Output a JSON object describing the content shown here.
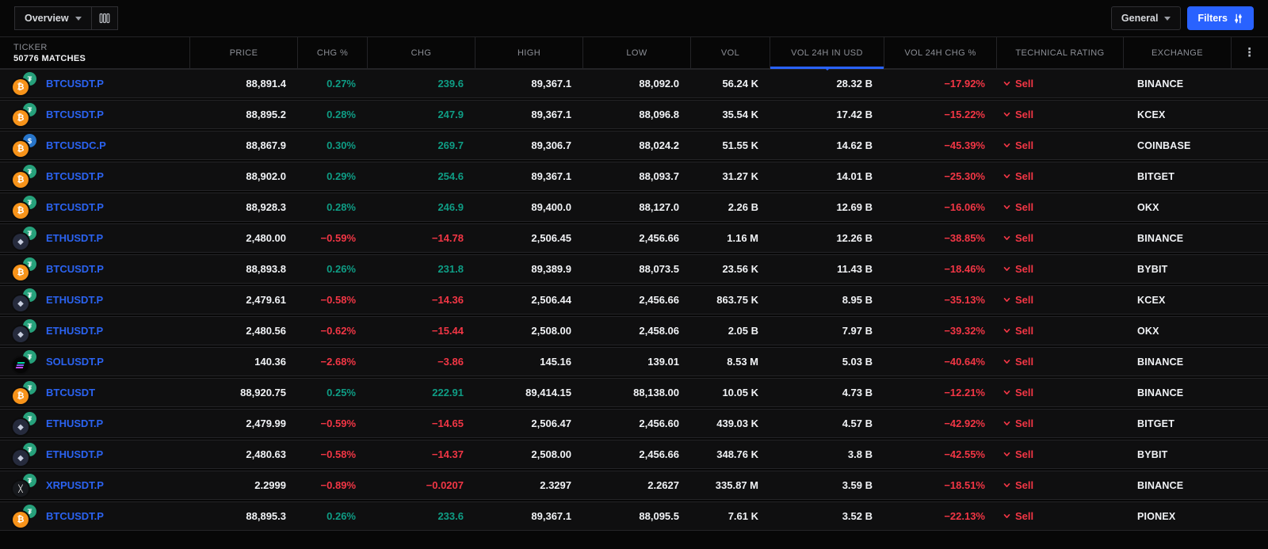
{
  "colors": {
    "accent": "#2962ff",
    "up": "#0f9d85",
    "down": "#f23645",
    "link": "#2b63f1"
  },
  "toolbar": {
    "view_dropdown": "Overview",
    "general_dropdown": "General",
    "filters_button": "Filters"
  },
  "table": {
    "ticker_header": "TICKER",
    "matches": "50776 MATCHES",
    "columns": [
      "PRICE",
      "CHG %",
      "CHG",
      "HIGH",
      "LOW",
      "VOL",
      "VOL 24H IN USD",
      "VOL 24H CHG %",
      "TECHNICAL RATING",
      "EXCHANGE"
    ],
    "sorted_column": "VOL 24H IN USD",
    "rows": [
      {
        "ticker": "BTCUSDT.P",
        "base": "BTC",
        "quote": "USDT",
        "price": "88,891.4",
        "chg_pct": "0.27%",
        "chg": "239.6",
        "high": "89,367.1",
        "low": "88,092.0",
        "vol": "56.24 K",
        "vol_usd": "28.32 B",
        "vol_chg": "−17.92%",
        "rating": "Sell",
        "exchange": "BINANCE"
      },
      {
        "ticker": "BTCUSDT.P",
        "base": "BTC",
        "quote": "USDT",
        "price": "88,895.2",
        "chg_pct": "0.28%",
        "chg": "247.9",
        "high": "89,367.1",
        "low": "88,096.8",
        "vol": "35.54 K",
        "vol_usd": "17.42 B",
        "vol_chg": "−15.22%",
        "rating": "Sell",
        "exchange": "KCEX"
      },
      {
        "ticker": "BTCUSDC.P",
        "base": "BTC",
        "quote": "USDC",
        "price": "88,867.9",
        "chg_pct": "0.30%",
        "chg": "269.7",
        "high": "89,306.7",
        "low": "88,024.2",
        "vol": "51.55 K",
        "vol_usd": "14.62 B",
        "vol_chg": "−45.39%",
        "rating": "Sell",
        "exchange": "COINBASE"
      },
      {
        "ticker": "BTCUSDT.P",
        "base": "BTC",
        "quote": "USDT",
        "price": "88,902.0",
        "chg_pct": "0.29%",
        "chg": "254.6",
        "high": "89,367.1",
        "low": "88,093.7",
        "vol": "31.27 K",
        "vol_usd": "14.01 B",
        "vol_chg": "−25.30%",
        "rating": "Sell",
        "exchange": "BITGET"
      },
      {
        "ticker": "BTCUSDT.P",
        "base": "BTC",
        "quote": "USDT",
        "price": "88,928.3",
        "chg_pct": "0.28%",
        "chg": "246.9",
        "high": "89,400.0",
        "low": "88,127.0",
        "vol": "2.26 B",
        "vol_usd": "12.69 B",
        "vol_chg": "−16.06%",
        "rating": "Sell",
        "exchange": "OKX"
      },
      {
        "ticker": "ETHUSDT.P",
        "base": "ETH",
        "quote": "USDT",
        "price": "2,480.00",
        "chg_pct": "−0.59%",
        "chg": "−14.78",
        "high": "2,506.45",
        "low": "2,456.66",
        "vol": "1.16 M",
        "vol_usd": "12.26 B",
        "vol_chg": "−38.85%",
        "rating": "Sell",
        "exchange": "BINANCE"
      },
      {
        "ticker": "BTCUSDT.P",
        "base": "BTC",
        "quote": "USDT",
        "price": "88,893.8",
        "chg_pct": "0.26%",
        "chg": "231.8",
        "high": "89,389.9",
        "low": "88,073.5",
        "vol": "23.56 K",
        "vol_usd": "11.43 B",
        "vol_chg": "−18.46%",
        "rating": "Sell",
        "exchange": "BYBIT"
      },
      {
        "ticker": "ETHUSDT.P",
        "base": "ETH",
        "quote": "USDT",
        "price": "2,479.61",
        "chg_pct": "−0.58%",
        "chg": "−14.36",
        "high": "2,506.44",
        "low": "2,456.66",
        "vol": "863.75 K",
        "vol_usd": "8.95 B",
        "vol_chg": "−35.13%",
        "rating": "Sell",
        "exchange": "KCEX"
      },
      {
        "ticker": "ETHUSDT.P",
        "base": "ETH",
        "quote": "USDT",
        "price": "2,480.56",
        "chg_pct": "−0.62%",
        "chg": "−15.44",
        "high": "2,508.00",
        "low": "2,458.06",
        "vol": "2.05 B",
        "vol_usd": "7.97 B",
        "vol_chg": "−39.32%",
        "rating": "Sell",
        "exchange": "OKX"
      },
      {
        "ticker": "SOLUSDT.P",
        "base": "SOL",
        "quote": "USDT",
        "price": "140.36",
        "chg_pct": "−2.68%",
        "chg": "−3.86",
        "high": "145.16",
        "low": "139.01",
        "vol": "8.53 M",
        "vol_usd": "5.03 B",
        "vol_chg": "−40.64%",
        "rating": "Sell",
        "exchange": "BINANCE"
      },
      {
        "ticker": "BTCUSDT",
        "base": "BTC",
        "quote": "USDT",
        "price": "88,920.75",
        "chg_pct": "0.25%",
        "chg": "222.91",
        "high": "89,414.15",
        "low": "88,138.00",
        "vol": "10.05 K",
        "vol_usd": "4.73 B",
        "vol_chg": "−12.21%",
        "rating": "Sell",
        "exchange": "BINANCE"
      },
      {
        "ticker": "ETHUSDT.P",
        "base": "ETH",
        "quote": "USDT",
        "price": "2,479.99",
        "chg_pct": "−0.59%",
        "chg": "−14.65",
        "high": "2,506.47",
        "low": "2,456.60",
        "vol": "439.03 K",
        "vol_usd": "4.57 B",
        "vol_chg": "−42.92%",
        "rating": "Sell",
        "exchange": "BITGET"
      },
      {
        "ticker": "ETHUSDT.P",
        "base": "ETH",
        "quote": "USDT",
        "price": "2,480.63",
        "chg_pct": "−0.58%",
        "chg": "−14.37",
        "high": "2,508.00",
        "low": "2,456.66",
        "vol": "348.76 K",
        "vol_usd": "3.8 B",
        "vol_chg": "−42.55%",
        "rating": "Sell",
        "exchange": "BYBIT"
      },
      {
        "ticker": "XRPUSDT.P",
        "base": "XRP",
        "quote": "USDT",
        "price": "2.2999",
        "chg_pct": "−0.89%",
        "chg": "−0.0207",
        "high": "2.3297",
        "low": "2.2627",
        "vol": "335.87 M",
        "vol_usd": "3.59 B",
        "vol_chg": "−18.51%",
        "rating": "Sell",
        "exchange": "BINANCE"
      },
      {
        "ticker": "BTCUSDT.P",
        "base": "BTC",
        "quote": "USDT",
        "price": "88,895.3",
        "chg_pct": "0.26%",
        "chg": "233.6",
        "high": "89,367.1",
        "low": "88,095.5",
        "vol": "7.61 K",
        "vol_usd": "3.52 B",
        "vol_chg": "−22.13%",
        "rating": "Sell",
        "exchange": "PIONEX"
      }
    ]
  }
}
